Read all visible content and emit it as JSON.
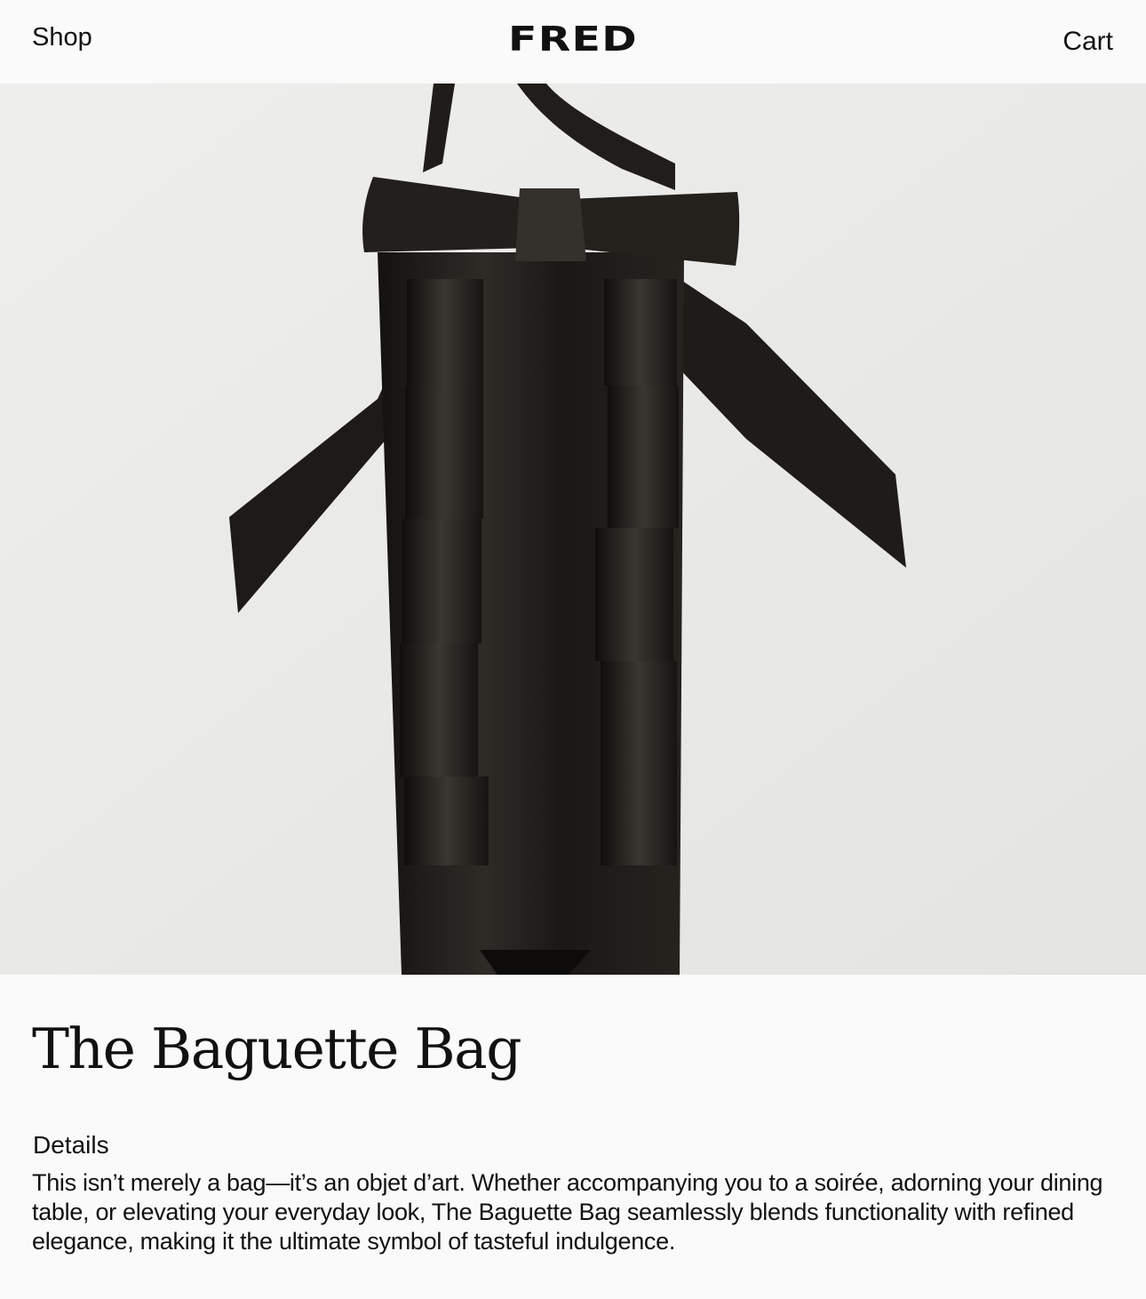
{
  "header": {
    "shop_label": "Shop",
    "logo_text": "FRED",
    "cart_label": "Cart"
  },
  "product": {
    "image_alt": "Black satin bag with bow and ruffled ribbons",
    "title": "The Baguette Bag",
    "details_label": "Details",
    "description": "This isn’t merely a bag—it’s an objet d’art. Whether accompanying you to a soirée, adorning your dining table, or elevating your everyday look, The Baguette Bag seamlessly blends functionality with refined elegance, making it the ultimate symbol of tasteful indulgence."
  },
  "colors": {
    "background": "#fafafa",
    "photo_background": "#e9e9e7",
    "satin": "#1c1a18",
    "text": "#111111"
  }
}
